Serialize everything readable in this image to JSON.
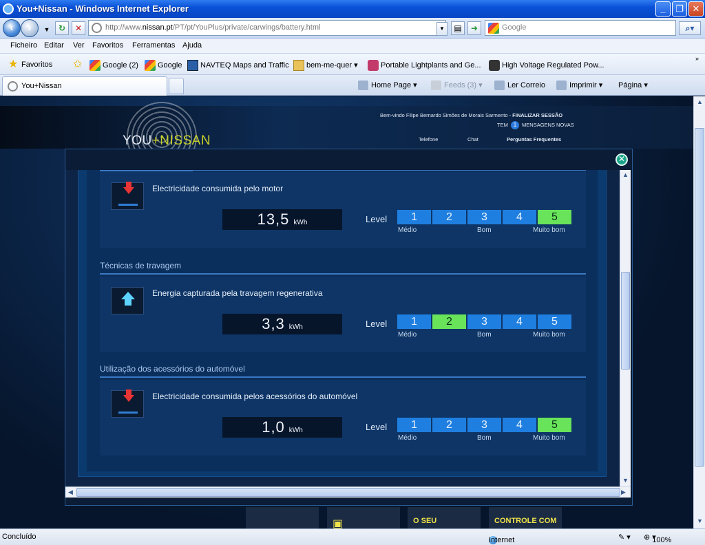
{
  "window": {
    "title": "You+Nissan - Windows Internet Explorer",
    "minimize": "_",
    "maximize": "❐",
    "close": "✕"
  },
  "address": {
    "url_prefix": "http://www.",
    "url_host": "nissan.pt",
    "url_path": "/PT/pt/YouPlus/private/carwings/battery.html",
    "search_placeholder": "Google"
  },
  "menu": [
    "Ficheiro",
    "Editar",
    "Ver",
    "Favoritos",
    "Ferramentas",
    "Ajuda"
  ],
  "favorites": {
    "label": "Favoritos",
    "items": [
      "Google (2)",
      "Google",
      "NAVTEQ Maps and Traffic",
      "bem-me-quer",
      "Portable Lightplants and Ge...",
      "High Voltage Regulated Pow..."
    ]
  },
  "tab": {
    "label": "You+Nissan"
  },
  "commands": {
    "home": "Home Page",
    "feeds": "Feeds (3)",
    "mail": "Ler Correio",
    "print": "Imprimir",
    "page": "Página"
  },
  "site": {
    "logo_you": "YOU",
    "logo_plus": "+",
    "logo_nissan": "NISSAN",
    "welcome": "Bem-vindo Filipe Bernardo Simões de Morais Sarmento -",
    "logout": "FINALIZAR SESSÃO",
    "msg_prefix": "TEM",
    "msg_count": "1",
    "msg_suffix": "MENSAGENS NOVAS",
    "links": [
      "Telefone",
      "Chat",
      "Perguntas Frequentes"
    ]
  },
  "modal": {
    "close_icon": "close-icon",
    "level_label": "Level",
    "scale_labels": [
      "Médio",
      "Bom",
      "Muito bom"
    ],
    "level_numbers": [
      "1",
      "2",
      "3",
      "4",
      "5"
    ],
    "cards": [
      {
        "section": "",
        "label": "Electricidade consumida pelo motor",
        "value": "13,5",
        "unit": "kWh",
        "icon": "arrow-down-icon",
        "level": 5
      },
      {
        "section": "Técnicas de travagem",
        "label": "Energia capturada pela travagem regenerativa",
        "value": "3,3",
        "unit": "kWh",
        "icon": "arrow-up-icon",
        "level": 2
      },
      {
        "section": "Utilização dos acessórios do automóvel",
        "label": "Electricidade consumida pelos acessórios do automóvel",
        "value": "1,0",
        "unit": "kWh",
        "icon": "arrow-down-icon",
        "level": 5
      }
    ]
  },
  "tiles": [
    "",
    "",
    "O SEU",
    "CONTROLE COM"
  ],
  "status": {
    "left": "Concluído",
    "zone": "Internet",
    "zoom": "100%"
  },
  "colors": {
    "level_default": "#1f7fe0",
    "level_active": "#68e35a",
    "accent_line": "#3a79c4"
  }
}
